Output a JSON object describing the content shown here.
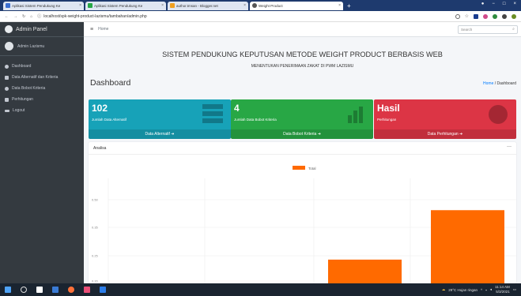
{
  "browser": {
    "tabs": [
      {
        "label": "Aplikasi Sistem Pendukung Ke"
      },
      {
        "label": "Aplikasi Sistem Pendukung Ke"
      },
      {
        "label": "author.tmsan - Blogger.net"
      },
      {
        "label": "Weight Product",
        "active": true
      }
    ],
    "new_tab": "+",
    "url": "localhost/spk-weight-product-lazismu/tambahan/admin.php"
  },
  "sidebar": {
    "brand": "Admin Panel",
    "user": "Admin Lazismu",
    "items": [
      {
        "label": "Dashboard",
        "icon": "dashboard-icon"
      },
      {
        "label": "Data Alternatif dan Kriteria",
        "icon": "table-icon"
      },
      {
        "label": "Data Bobot Kriteria",
        "icon": "pie-icon"
      },
      {
        "label": "Perhitungan",
        "icon": "table-icon"
      },
      {
        "label": "Logout",
        "icon": "logout-icon"
      }
    ]
  },
  "topnav": {
    "home": "Home",
    "search_placeholder": "Search"
  },
  "header": {
    "title": "SISTEM PENDUKUNG KEPUTUSAN METODE WEIGHT PRODUCT BERBASIS WEB",
    "subtitle": "MENENTUKAN PENERIMAAN ZAKAT DI PWM LAZISMU",
    "page": "Dashboard",
    "breadcrumb_home": "Home",
    "breadcrumb_sep": "/",
    "breadcrumb_current": "Dashboard"
  },
  "boxes": [
    {
      "value": "102",
      "label": "Jumlah Data Alternatif",
      "footer": "Data Alternatif",
      "color": "#17a2b8"
    },
    {
      "value": "4",
      "label": "Jumlah Data Bobot Kriteria",
      "footer": "Data Bobot Kriteria",
      "color": "#28a745"
    },
    {
      "value": "Hasil",
      "label": "Perhitungan",
      "footer": "Data Perhitungan",
      "color": "#dc3545"
    }
  ],
  "panel": {
    "title": "Analisa",
    "collapse": "—"
  },
  "chart_data": {
    "type": "bar",
    "legend": [
      "Total"
    ],
    "series_color": "#ff6a00",
    "yticks": [
      "0.50",
      "0.35",
      "0.25",
      "0.20"
    ],
    "values": [
      0.2,
      0.34
    ]
  },
  "taskbar": {
    "weather": "29°C Hujan ringan",
    "time": "11:14 AM",
    "date": "5/3/2021"
  }
}
